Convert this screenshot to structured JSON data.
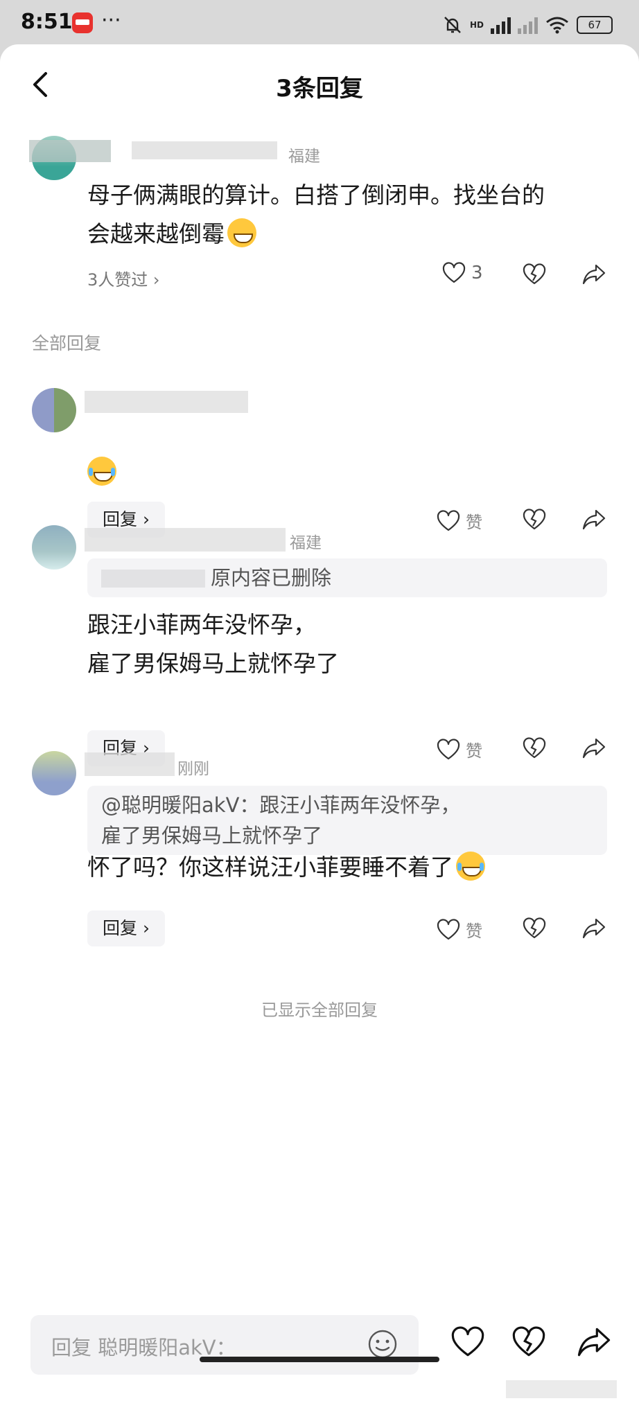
{
  "status_bar": {
    "time": "8:51",
    "dots": "···",
    "battery": "67",
    "net": "HD"
  },
  "header": {
    "title": "3条回复"
  },
  "root_comment": {
    "meta": "福建",
    "content_line1": "母子俩满眼的算计。白搭了倒闭申。找坐台的",
    "content_line2": "会越来越倒霉",
    "likes_summary": "3人赞过 ›",
    "like_count": "3"
  },
  "section_label": "全部回复",
  "replies": [
    {
      "meta": "",
      "content": "",
      "reply_label": "回复 ›",
      "like_label": "赞"
    },
    {
      "meta": "福建",
      "quote": "原内容已删除",
      "content_line1": "跟汪小菲两年没怀孕，",
      "content_line2": "雇了男保姆马上就怀孕了",
      "reply_label": "回复 ›",
      "like_label": "赞"
    },
    {
      "meta": "刚刚",
      "quote_line1": "@聪明暖阳akV：跟汪小菲两年没怀孕，",
      "quote_line2": "雇了男保姆马上就怀孕了",
      "content": "怀了吗？你这样说汪小菲要睡不着了",
      "reply_label": "回复 ›",
      "like_label": "赞"
    }
  ],
  "end_note": "已显示全部回复",
  "composer": {
    "placeholder": "回复 聪明暖阳akV："
  },
  "icons": [
    "back-arrow-icon",
    "heart-icon",
    "broken-heart-icon",
    "share-icon",
    "emoji-icon",
    "grin-emoji-icon",
    "laugh-cry-emoji-icon"
  ]
}
